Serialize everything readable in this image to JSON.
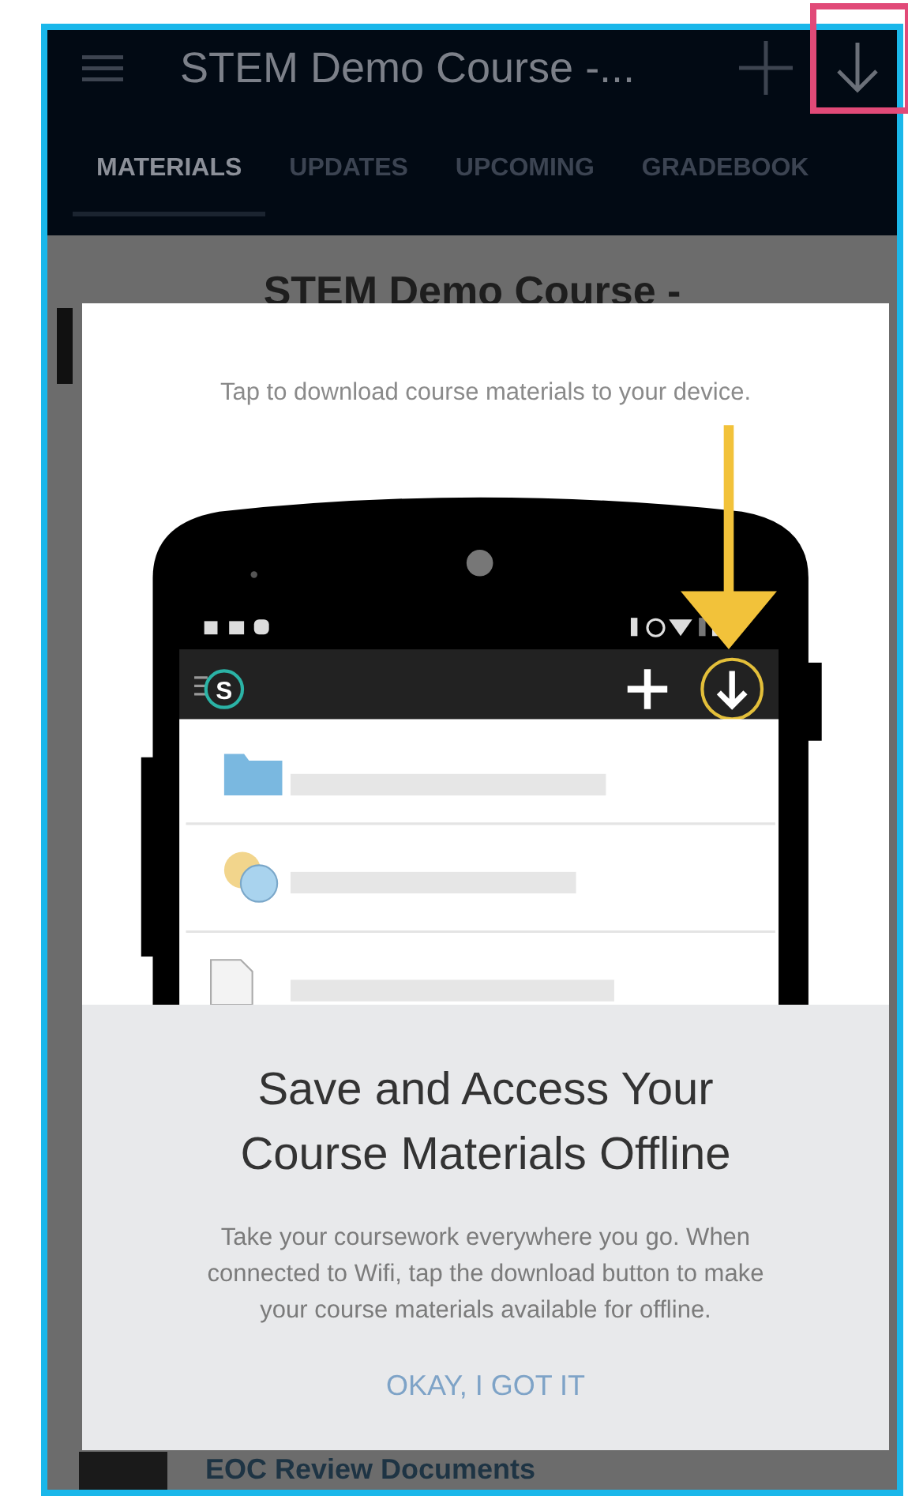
{
  "app_bar": {
    "title": "STEM Demo Course -..."
  },
  "tabs": [
    {
      "label": "MATERIALS",
      "selected": true
    },
    {
      "label": "UPDATES",
      "selected": false
    },
    {
      "label": "UPCOMING",
      "selected": false
    },
    {
      "label": "GRADEBOOK",
      "selected": false
    }
  ],
  "content": {
    "title": "STEM Demo Course -",
    "items": [
      "EOC Review Documents"
    ]
  },
  "dialog": {
    "hint": "Tap to download course materials to your device.",
    "illustration": {
      "logo_letter": "S"
    },
    "title": "Save and Access Your Course Materials Offline",
    "body": "Take your coursework everywhere you go. When connected to Wifi, tap the download button to make your course materials available for offline.",
    "button": "OKAY, I GOT IT"
  }
}
